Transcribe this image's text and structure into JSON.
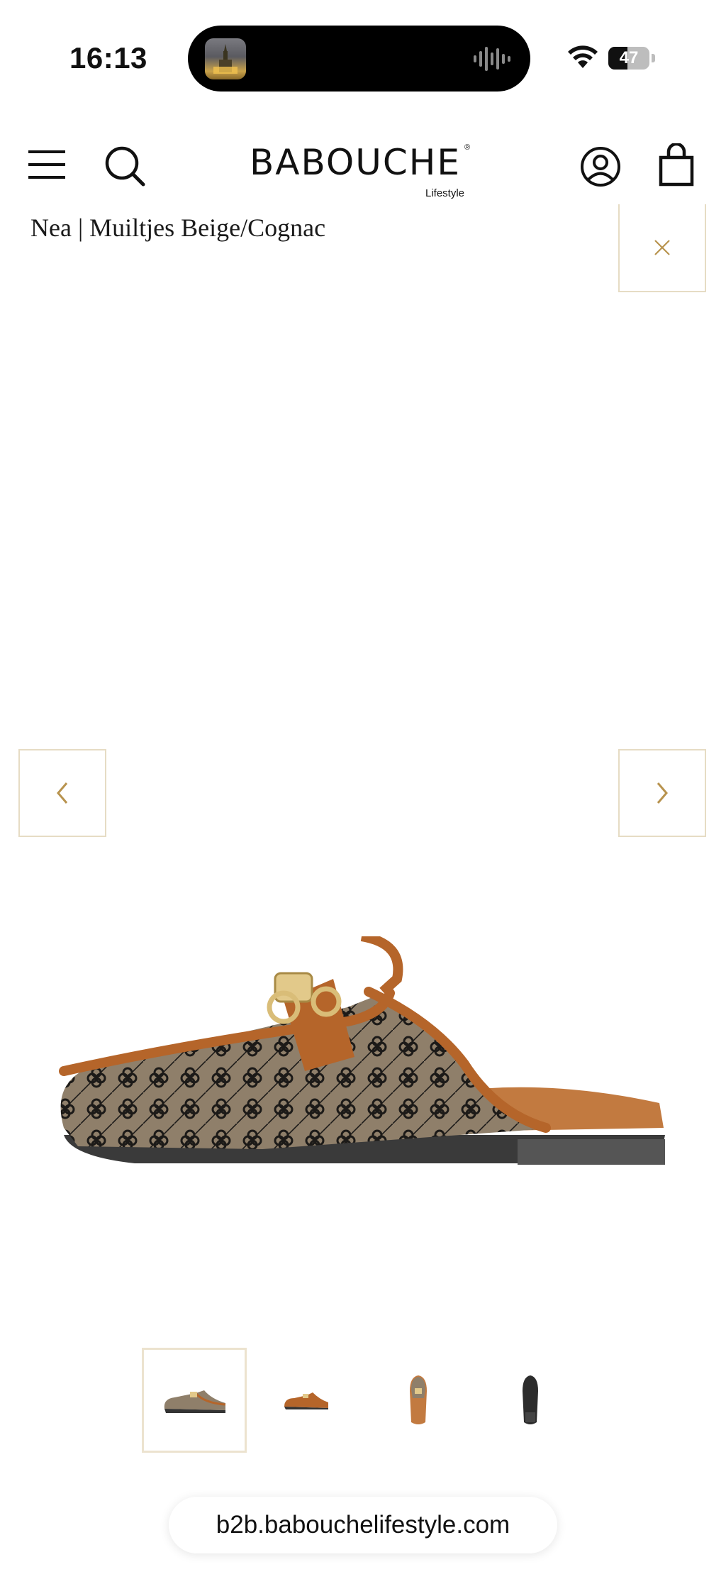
{
  "status_bar": {
    "time": "16:13",
    "battery_level": "47",
    "battery_fraction": 0.47
  },
  "header": {
    "logo_text": "BABOUCHE",
    "logo_subtext": "Lifestyle",
    "logo_mark": "®",
    "icons": [
      "menu-icon",
      "search-icon",
      "account-icon",
      "bag-icon"
    ]
  },
  "product": {
    "title": "Nea | Muiltjes Beige/Cognac",
    "thumbnails_count": 4,
    "active_thumbnail": 1
  },
  "colors": {
    "accent_gold": "#b8934e",
    "border_beige": "#e6dcc4",
    "leather_cognac": "#b5652a",
    "canvas_beige": "#8f7f6a"
  },
  "browser": {
    "url": "b2b.babouchelifestyle.com"
  }
}
